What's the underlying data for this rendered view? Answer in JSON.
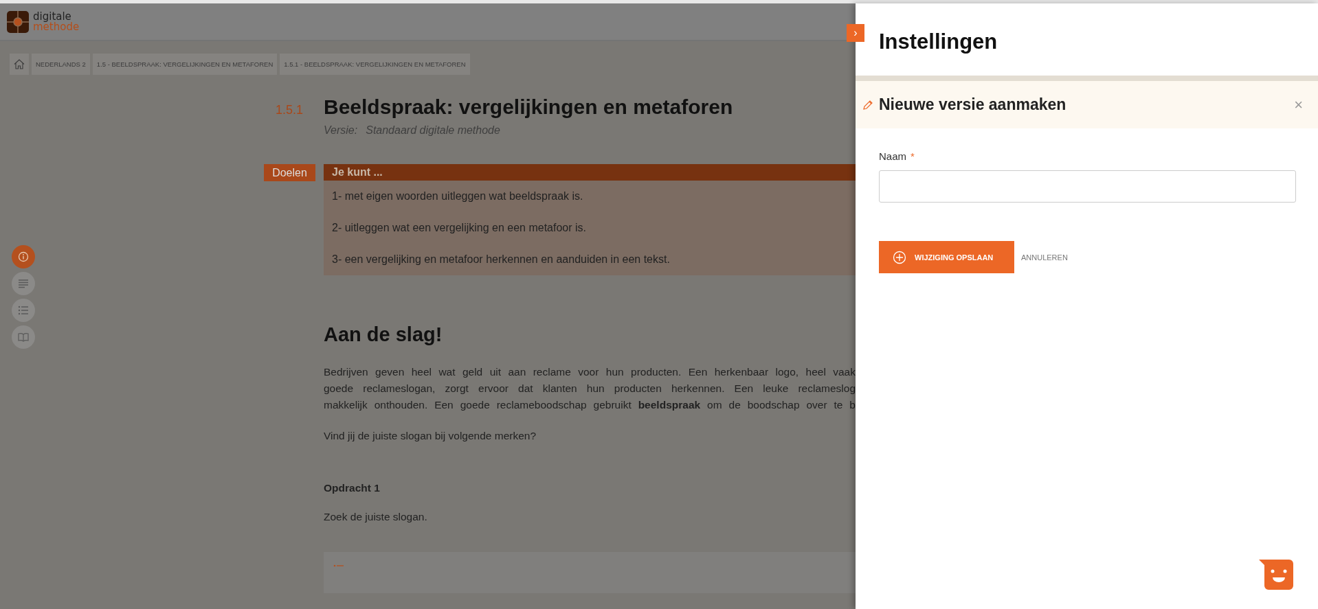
{
  "logo": {
    "line_1": "digitale",
    "line_2": "methode"
  },
  "breadcrumbs": [
    "NEDERLANDS 2",
    "1.5 - BEELDSPRAAK: VERGELIJKINGEN EN METAFOREN",
    "1.5.1 - BEELDSPRAAK: VERGELIJKINGEN EN METAFOREN"
  ],
  "side_nav": [
    {
      "kind": "info",
      "selected": true
    },
    {
      "kind": "text",
      "selected": false
    },
    {
      "kind": "list",
      "selected": false
    },
    {
      "kind": "book",
      "selected": false
    }
  ],
  "lesson": {
    "number": "1.5.1",
    "title": "Beeldspraak: vergelijkingen en metaforen",
    "version_label": "Versie:",
    "version": "Standaard digitale methode"
  },
  "goals": {
    "tag": "Doelen",
    "heading": "Je kunt ...",
    "items": [
      "1- met eigen woorden uitleggen wat beeldspraak is.",
      "2- uitleggen wat een vergelijking en een metafoor is.",
      "3- een vergelijking en metafoor herkennen en aanduiden in een tekst."
    ]
  },
  "section": {
    "heading": "Aan de slag!",
    "paragraph_lines": [
      "Bedrijven geven heel wat geld uit aan reclame voor hun producten. Een herkenbaar logo, heel vaak",
      "goede reclameslogan, zorgt ervoor dat klanten hun producten herkennen. Een leuke reclameslog",
      "makkelijk onthouden. Een goede reclameboodschap gebruikt **beeldspraak** om de boodschap over te b"
    ],
    "prompt": "Vind jij de juiste slogan bij volgende merken?",
    "assignment": "Opdracht 1",
    "instruction": "Zoek de juiste slogan."
  },
  "settings_panel": {
    "collapse_button": "›",
    "title": "Instellingen",
    "form_title": "Nieuwe versie aanmaken",
    "close": "×",
    "name_label": "Naam",
    "required_mark": "*",
    "save_button": "WIJZIGING OPSLAAN",
    "cancel_button": "ANNULEREN"
  }
}
